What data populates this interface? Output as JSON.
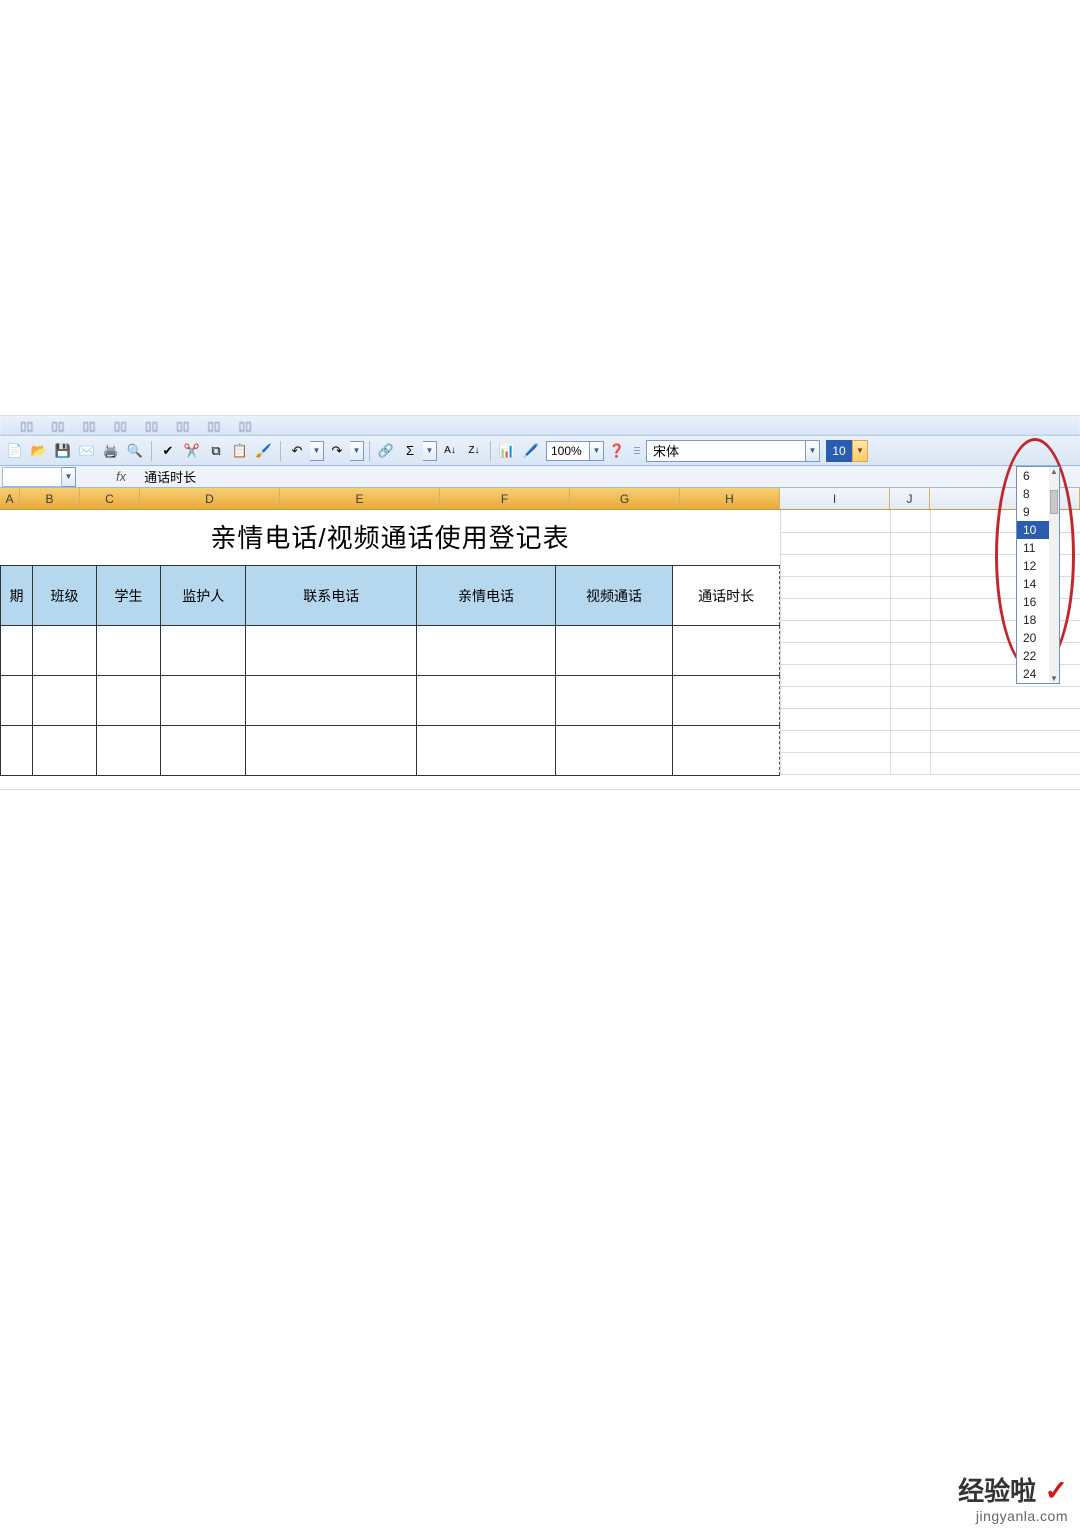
{
  "toolbar": {
    "zoom": "100%",
    "font_name": "宋体",
    "font_size": "10"
  },
  "formula": {
    "cell_ref": "",
    "fx_label": "fx",
    "value": "通话时长"
  },
  "columns": [
    "A",
    "B",
    "C",
    "D",
    "E",
    "F",
    "G",
    "H",
    "I",
    "J"
  ],
  "sheet": {
    "title": "亲情电话/视频通话使用登记表",
    "headers": [
      "期",
      "班级",
      "学生",
      "监护人",
      "联系电话",
      "亲情电话",
      "视频通话",
      "通话时长"
    ]
  },
  "size_options": [
    "6",
    "8",
    "9",
    "10",
    "11",
    "12",
    "14",
    "16",
    "18",
    "20",
    "22",
    "24"
  ],
  "size_selected": "10",
  "watermark": {
    "brand": "经验啦",
    "url": "jingyanla.com"
  }
}
